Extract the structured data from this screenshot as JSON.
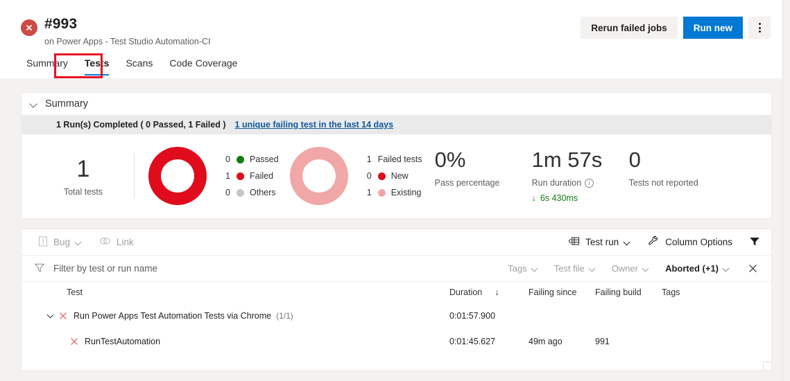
{
  "header": {
    "status_icon": "error-circle-icon",
    "build_number": "#993",
    "pipeline": "on Power Apps - Test Studio Automation-CI",
    "rerun_label": "Rerun failed jobs",
    "run_new_label": "Run new",
    "more_label": "more-actions"
  },
  "tabs": [
    {
      "label": "Summary",
      "active": false
    },
    {
      "label": "Tests",
      "active": true
    },
    {
      "label": "Scans",
      "active": false
    },
    {
      "label": "Code Coverage",
      "active": false
    }
  ],
  "summary": {
    "title": "Summary",
    "strip_text": "1 Run(s) Completed ( 0 Passed, 1 Failed )",
    "strip_link": "1 unique failing test in the last 14 days",
    "total": {
      "value": "1",
      "label": "Total tests"
    },
    "outcome_donut": {
      "red_pct": 100,
      "legend": [
        {
          "count": "0",
          "label": "Passed",
          "color": "#107c10"
        },
        {
          "count": "1",
          "label": "Failed",
          "color": "#e00b1c"
        },
        {
          "count": "0",
          "label": "Others",
          "color": "#c8c6c4"
        }
      ]
    },
    "failure_donut": {
      "pink_pct": 100,
      "legend": [
        {
          "count": "1",
          "label": "Failed tests",
          "color": ""
        },
        {
          "count": "0",
          "label": "New",
          "color": "#e00b1c"
        },
        {
          "count": "1",
          "label": "Existing",
          "color": "#f1a7a7"
        }
      ]
    },
    "pass_percentage": {
      "value": "0%",
      "label": "Pass percentage"
    },
    "run_duration": {
      "value": "1m 57s",
      "label": "Run duration",
      "delta": "6s 430ms",
      "delta_dir": "down",
      "delta_color": "#107c10"
    },
    "not_reported": {
      "value": "0",
      "label": "Tests not reported"
    }
  },
  "toolbar": {
    "bug_label": "Bug",
    "link_label": "Link",
    "test_run_label": "Test run",
    "column_options_label": "Column Options",
    "filter_icon": "funnel-filter-icon"
  },
  "filters": {
    "search_placeholder": "Filter by test or run name",
    "search_value": "",
    "pills": [
      {
        "label": "Tags",
        "active": false
      },
      {
        "label": "Test file",
        "active": false
      },
      {
        "label": "Owner",
        "active": false
      },
      {
        "label": "Aborted (+1)",
        "active": true
      }
    ],
    "clear_label": "clear-filters"
  },
  "grid": {
    "columns": [
      "Test",
      "Duration",
      "Failing since",
      "Failing build",
      "Tags"
    ],
    "sort_column": "Duration",
    "sort_dir": "↓",
    "rows": [
      {
        "level": 1,
        "expanded": true,
        "status": "failed",
        "test": "Run Power Apps Test Automation Tests via Chrome",
        "count": "(1/1)",
        "duration": "0:01:57.900",
        "failing_since": "",
        "failing_build": "",
        "tags": ""
      },
      {
        "level": 2,
        "expanded": false,
        "status": "failed",
        "test": "RunTestAutomation",
        "count": "",
        "duration": "0:01:45.627",
        "failing_since": "49m ago",
        "failing_build": "991",
        "tags": ""
      }
    ]
  },
  "colors": {
    "accent": "#0078d4",
    "fail_red": "#e00b1c",
    "pass_green": "#107c10",
    "existing_pink": "#f1a7a7",
    "highlight_box": "#e81123"
  }
}
